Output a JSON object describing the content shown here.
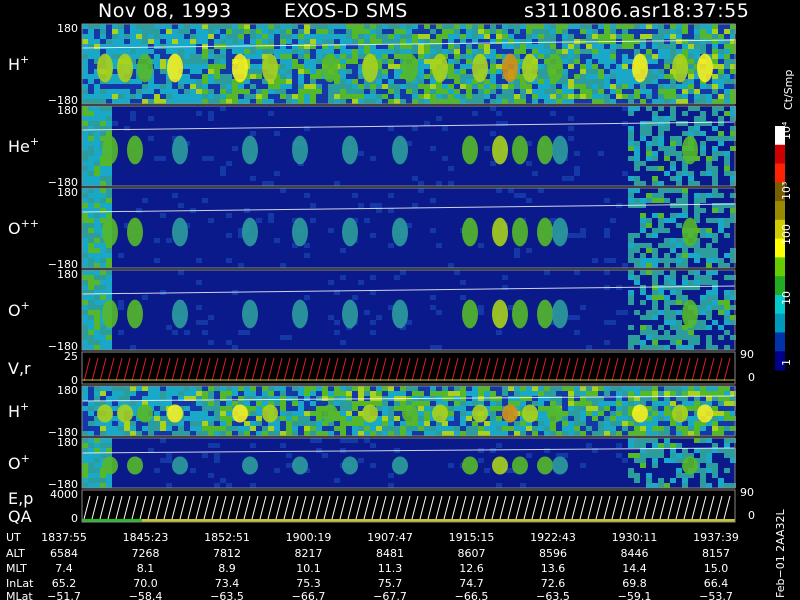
{
  "header": {
    "date": "Nov 08, 1993",
    "instrument": "EXOS-D SMS",
    "file": "s3110806.asr",
    "time": "18:37:55"
  },
  "colorbar": {
    "unit_label": "Ct/Smp",
    "ticks": [
      "10⁴",
      "10³",
      "100",
      "10",
      "1"
    ],
    "colors": [
      "#ffffff",
      "#cc0000",
      "#ff2200",
      "#7a5c00",
      "#998800",
      "#cccc00",
      "#ffff00",
      "#66cc00",
      "#22aa22",
      "#00cccc",
      "#0099bb",
      "#0033aa",
      "#000088"
    ]
  },
  "panels": [
    {
      "label": "H",
      "sup": "+",
      "top": "180",
      "bottom": "−180"
    },
    {
      "label": "He",
      "sup": "+",
      "top": "180",
      "bottom": "−180"
    },
    {
      "label": "O",
      "sup": "++",
      "top": "180",
      "bottom": "−180"
    },
    {
      "label": "O",
      "sup": "+",
      "top": "180",
      "bottom": "−180"
    },
    {
      "label": "V,r",
      "sup": "",
      "top": "25",
      "bottom": "0",
      "right_top": "90",
      "right_bottom": "0"
    },
    {
      "label": "H",
      "sup": "+",
      "top": "180",
      "bottom": "−180"
    },
    {
      "label": "O",
      "sup": "+",
      "top": "180",
      "bottom": "−180"
    },
    {
      "label": "E,p",
      "label2": "QA",
      "sup": "",
      "top": "4000",
      "bottom": "0",
      "right_top": "90",
      "right_bottom": "0"
    }
  ],
  "table": {
    "row_labels": [
      "UT",
      "ALT",
      "MLT",
      "InLat",
      "MLat"
    ],
    "columns": [
      [
        "1837:55",
        "6584",
        "7.4",
        "65.2",
        "−51.7"
      ],
      [
        "1845:23",
        "7268",
        "8.1",
        "70.0",
        "−58.4"
      ],
      [
        "1852:51",
        "7812",
        "8.9",
        "73.4",
        "−63.5"
      ],
      [
        "1900:19",
        "8217",
        "10.1",
        "75.3",
        "−66.7"
      ],
      [
        "1907:47",
        "8481",
        "11.3",
        "75.7",
        "−67.7"
      ],
      [
        "1915:15",
        "8607",
        "12.6",
        "74.7",
        "−66.5"
      ],
      [
        "1922:43",
        "8596",
        "13.6",
        "72.6",
        "−63.5"
      ],
      [
        "1930:11",
        "8446",
        "14.4",
        "69.8",
        "−59.1"
      ],
      [
        "1937:39",
        "8157",
        "15.0",
        "66.4",
        "−53.7"
      ]
    ]
  },
  "footer_code": "Feb−01 2AA32L",
  "chart_data": {
    "type": "heatmap",
    "title": "Nov 08, 1993   EXOS-D SMS",
    "x_axis": "UT",
    "x_ticks": [
      "1837:55",
      "1845:23",
      "1852:51",
      "1900:19",
      "1907:47",
      "1915:15",
      "1922:43",
      "1930:11",
      "1937:39"
    ],
    "series": [
      {
        "name": "H+",
        "ylim": [
          -180,
          180
        ]
      },
      {
        "name": "He+",
        "ylim": [
          -180,
          180
        ]
      },
      {
        "name": "O++",
        "ylim": [
          -180,
          180
        ]
      },
      {
        "name": "O+",
        "ylim": [
          -180,
          180
        ]
      },
      {
        "name": "V,r",
        "ylim": [
          0,
          25
        ]
      },
      {
        "name": "H+",
        "ylim": [
          -180,
          180
        ]
      },
      {
        "name": "O+",
        "ylim": [
          -180,
          180
        ]
      },
      {
        "name": "E,p QA",
        "ylim": [
          0,
          4000
        ]
      }
    ],
    "colorbar_scale": "log",
    "colorbar_range": [
      1,
      10000
    ]
  }
}
